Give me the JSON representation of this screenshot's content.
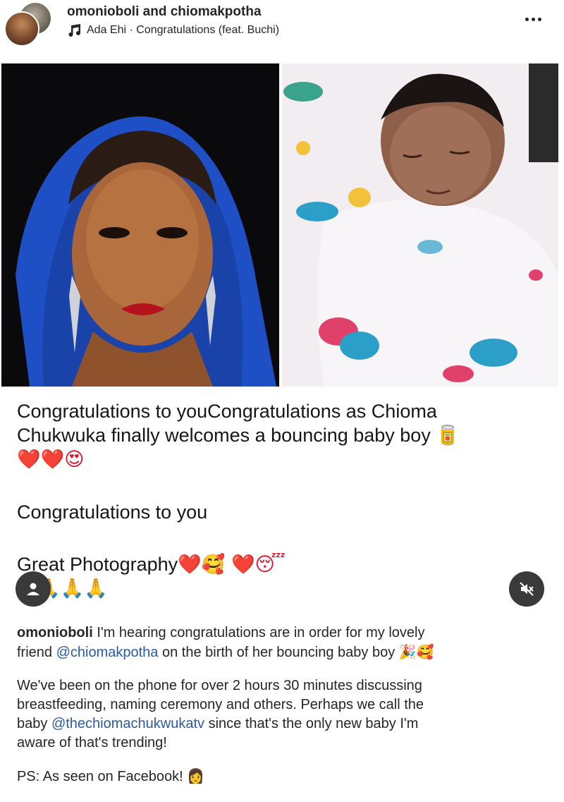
{
  "header": {
    "user1": "omonioboli",
    "conjunction": "and",
    "user2": "chiomakpotha",
    "music": "Ada Ehi · Congratulations (feat. Buchi)"
  },
  "overlay": {
    "line1": "Congratulations to youCongratulations as Chioma",
    "line2": "Chukwuka finally welcomes a bouncing baby boy",
    "line2_emoji": "🥫",
    "line3_emoji": "❤️❤️😍",
    "line4": "Congratulations to you",
    "line5": "Great Photography",
    "line5_emoji": "❤️🥰 ❤️😴",
    "line6_emoji": "🙏🙏🙏"
  },
  "caption": {
    "user": "omonioboli",
    "p1_a": "I'm hearing congratulations are in order for my lovely",
    "p1_b": "friend",
    "mention1": "@chiomakpotha",
    "p1_c": "on the birth of her bouncing baby boy",
    "p1_emoji": "🎉🥰",
    "p2_a": "We've been on the phone for over 2 hours 30 minutes discussing",
    "p2_b": "breastfeeding, naming ceremony and others. Perhaps we call the",
    "p2_c": "baby",
    "mention2": "@thechiomachukwukatv",
    "p2_d": "since that's the only new baby I'm",
    "p2_e": "aware of that's trending!",
    "p3": "PS: As seen on Facebook!",
    "p3_emoji": "👩"
  },
  "icons": [
    "music-icon",
    "more-icon",
    "user-tag-icon",
    "mute-icon"
  ]
}
